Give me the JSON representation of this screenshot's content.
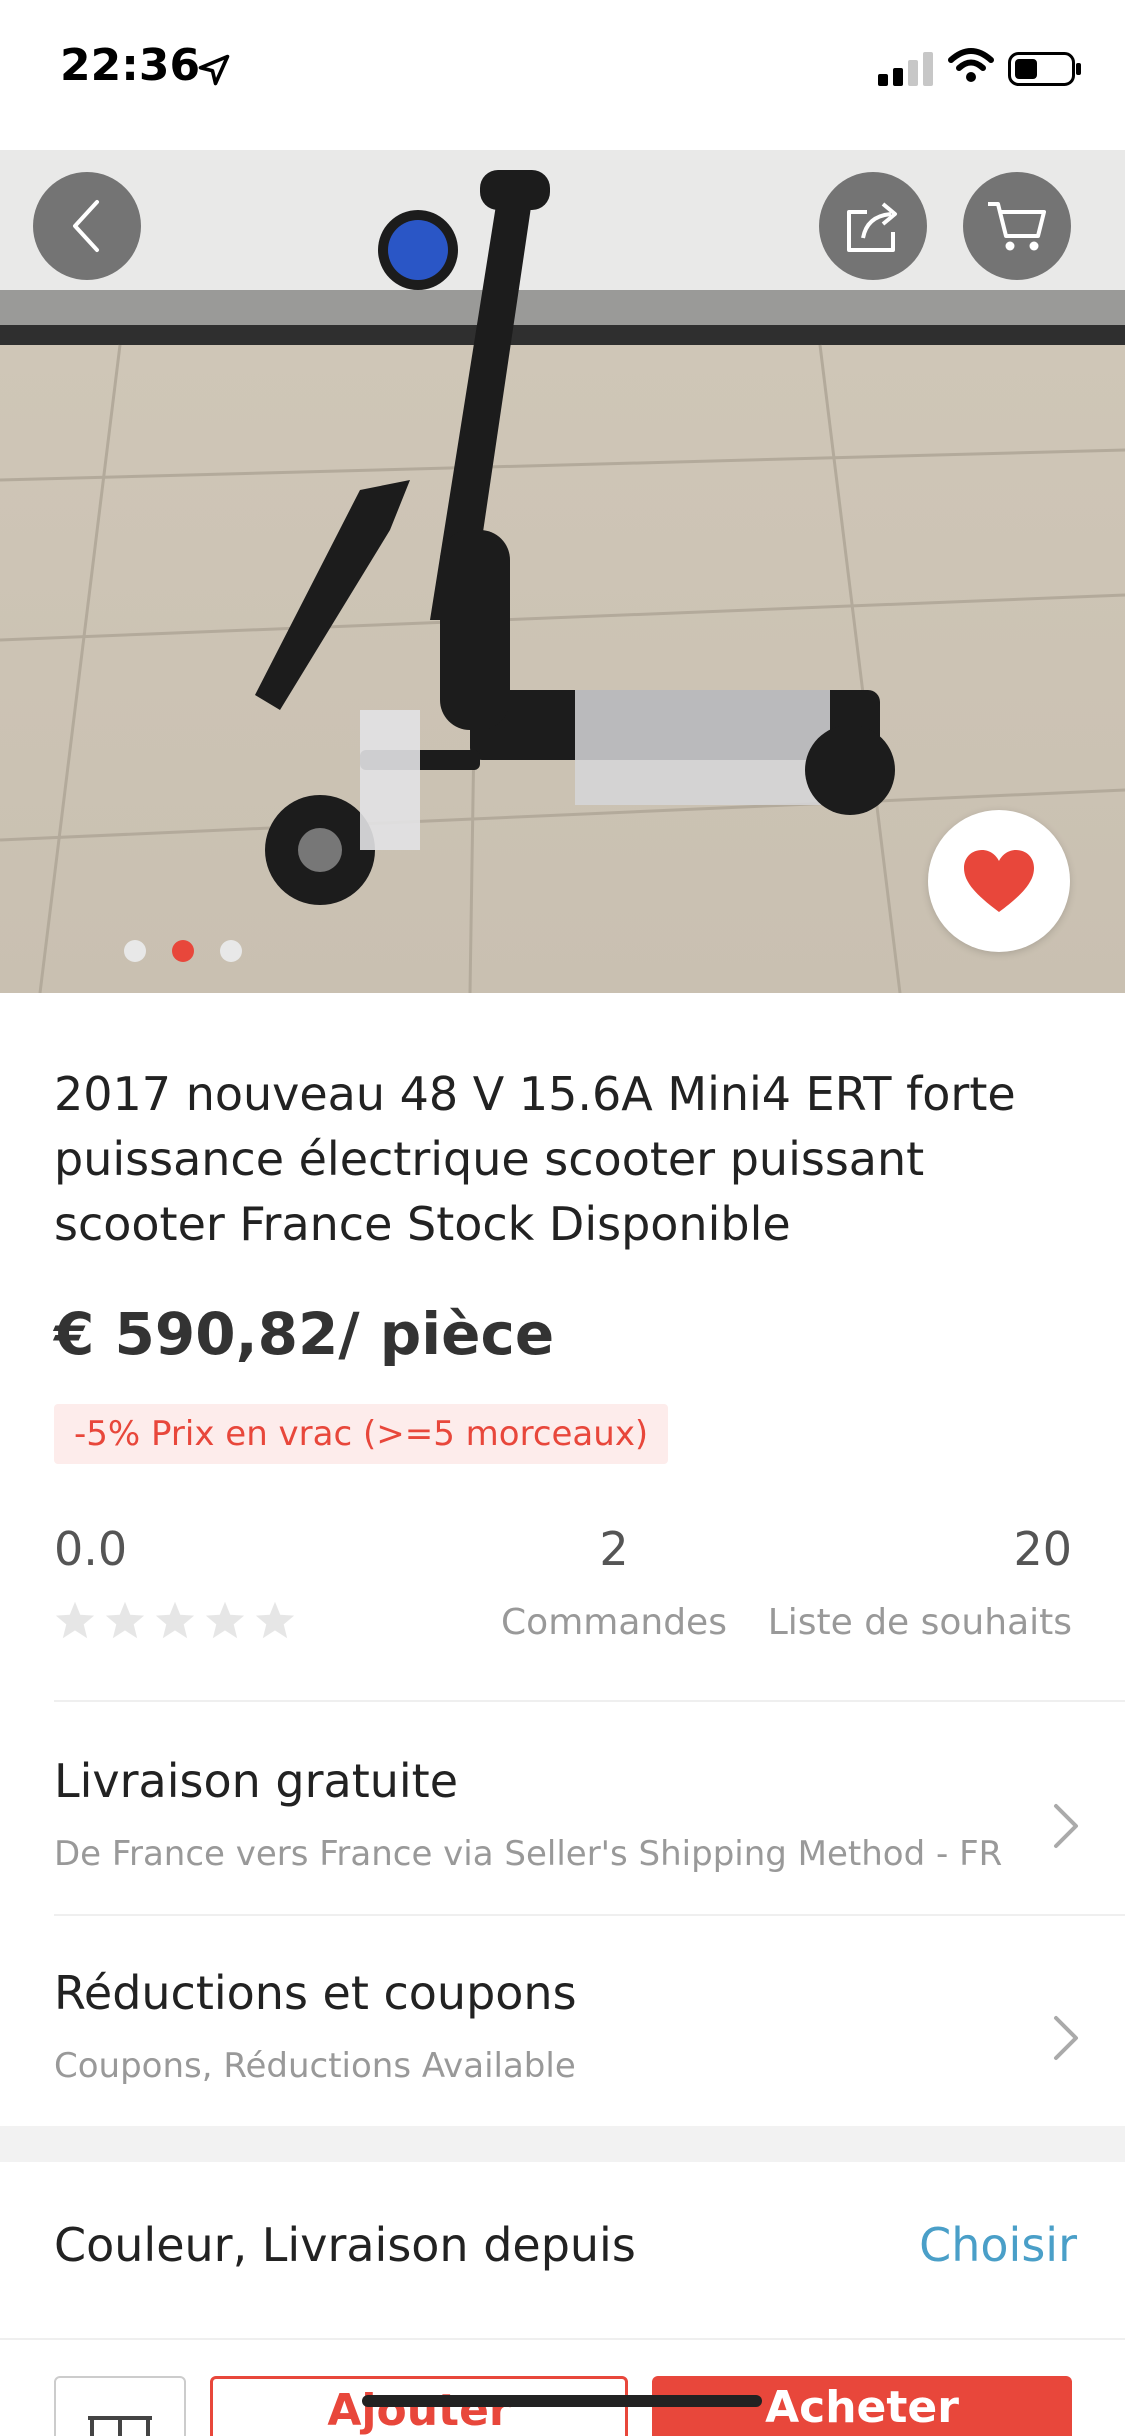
{
  "status_bar": {
    "time": "22:36"
  },
  "hero": {
    "back_icon": "chevron-left-icon",
    "share_icon": "share-icon",
    "cart_icon": "cart-icon",
    "favorite_icon": "heart-icon",
    "pager_count": 3,
    "pager_active_index": 1
  },
  "product": {
    "title": "2017 nouveau 48 V 15.6A Mini4 ERT forte puissance électrique scooter puissant scooter France Stock Disponible",
    "price": "€ 590,82/ pièce",
    "promo": "-5% Prix en vrac (>=5 morceaux)"
  },
  "stats": {
    "rating_value": "0.0",
    "rating_stars": 0,
    "orders_value": "2",
    "orders_label": "Commandes",
    "wishlist_value": "20",
    "wishlist_label": "Liste de souhaits"
  },
  "shipping": {
    "title": "Livraison gratuite",
    "subtitle": "De France vers France via Seller's Shipping Method - FR"
  },
  "coupons": {
    "title": "Réductions et coupons",
    "subtitle": "Coupons, Réductions Available"
  },
  "variant": {
    "label": "Couleur, Livraison depuis",
    "action": "Choisir"
  },
  "actions": {
    "add_label": "Ajouter",
    "buy_label": "Acheter"
  },
  "colors": {
    "accent": "#e8473b",
    "link": "#4a9fc8"
  }
}
